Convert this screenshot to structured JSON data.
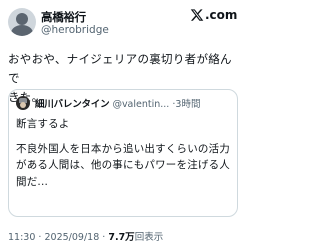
{
  "author": {
    "display_name": "高橋裕行",
    "handle": "@herobridge"
  },
  "brand": {
    "logo_icon": "x-logo-icon",
    "suffix": ".com"
  },
  "tweet": {
    "lines": [
      "おやおや、ナイジェリアの裏切り者が絡んで",
      "きた。"
    ]
  },
  "quote": {
    "display_name": "細川バレンタイン",
    "handle": "@valentin...",
    "separator": "·",
    "time": "3時間",
    "lines": [
      "断言するよ",
      "不良外国人を日本から追い出すくらいの活力",
      "がある人間は、他の事にもパワーを注げる人",
      "間だ..."
    ]
  },
  "footer": {
    "time": "11:30",
    "separator": "·",
    "date": "2025/09/18",
    "views_count": "7.7万",
    "views_label": "回表示"
  }
}
